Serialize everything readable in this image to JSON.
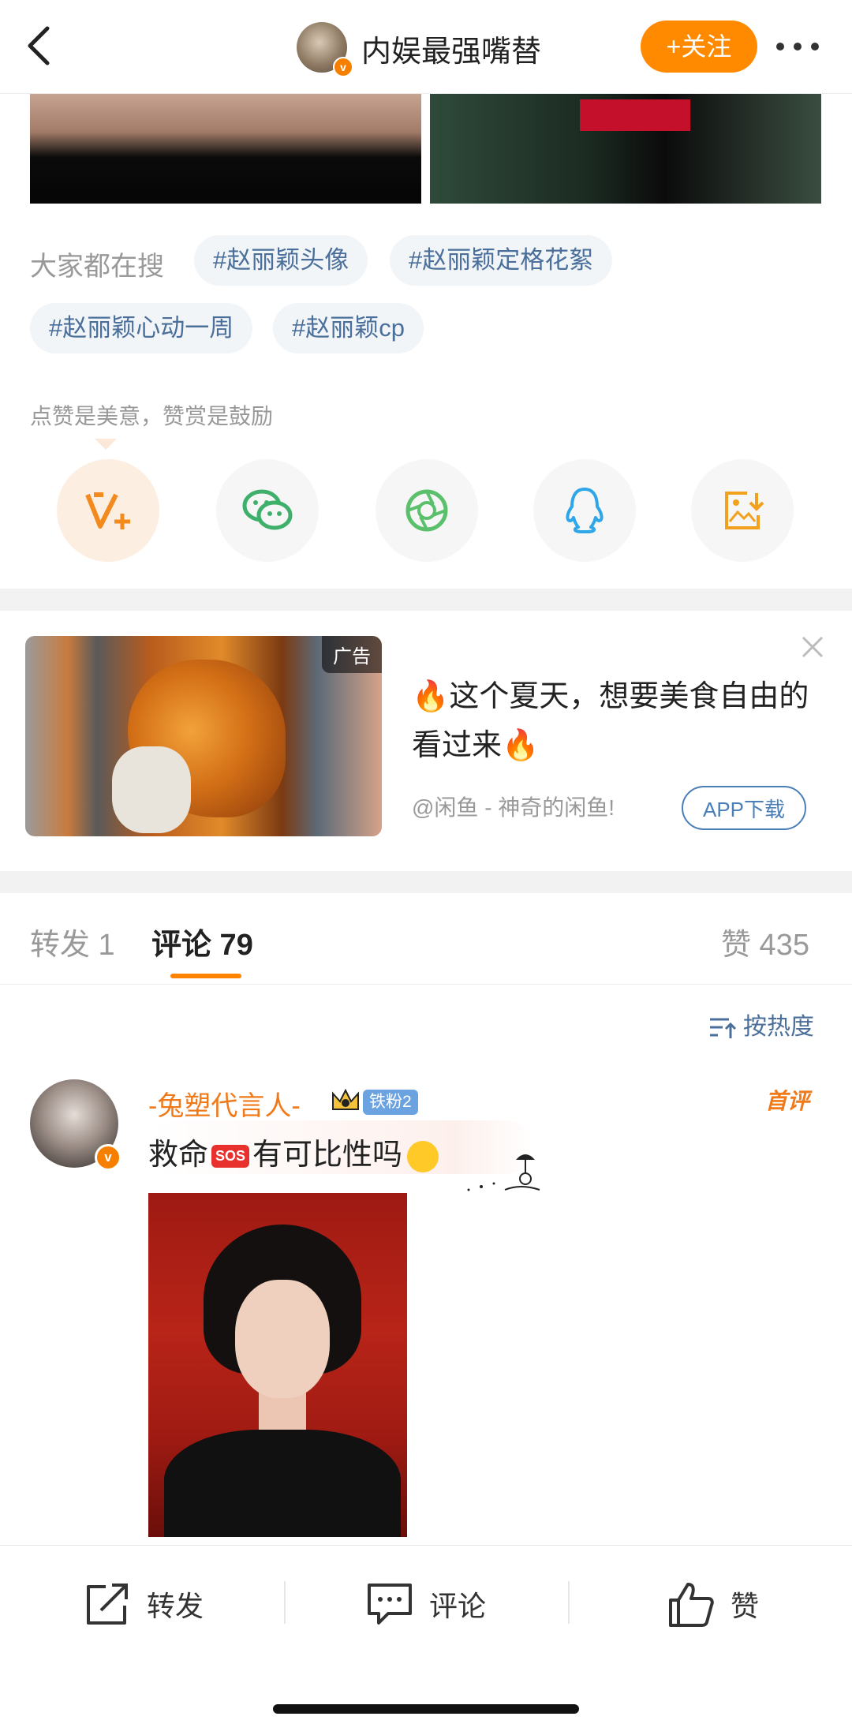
{
  "header": {
    "title": "内娱最强嘴替",
    "follow_label": "+关注",
    "avatar_badge": "v"
  },
  "search": {
    "label": "大家都在搜",
    "tags": [
      "#赵丽颖头像",
      "#赵丽颖定格花絮",
      "#赵丽颖心动一周",
      "#赵丽颖cp"
    ]
  },
  "cheer_text": "点赞是美意，赞赏是鼓励",
  "share_icons": [
    "vplus-icon",
    "wechat-icon",
    "moments-icon",
    "qq-icon",
    "save-image-icon"
  ],
  "ad": {
    "tag": "广告",
    "text": "🔥这个夏天，想要美食自由的看过来🔥",
    "source": "@闲鱼 - 神奇的闲鱼!",
    "button": "APP下载"
  },
  "tabs": {
    "repost": "转发 1",
    "comment": "评论 79",
    "like": "赞 435"
  },
  "sort_label": "按热度",
  "comment": {
    "username": "-兔塑代言人-",
    "fan_badge": "铁粉2",
    "top_label": "首评",
    "text_before": "救命",
    "sos": "SOS",
    "text_after": "有可比性吗"
  },
  "bottom": {
    "repost": "转发",
    "comment": "评论",
    "like": "赞"
  },
  "colors": {
    "accent": "#ff8200",
    "link": "#4a6f9a",
    "username": "#f07a1a"
  }
}
